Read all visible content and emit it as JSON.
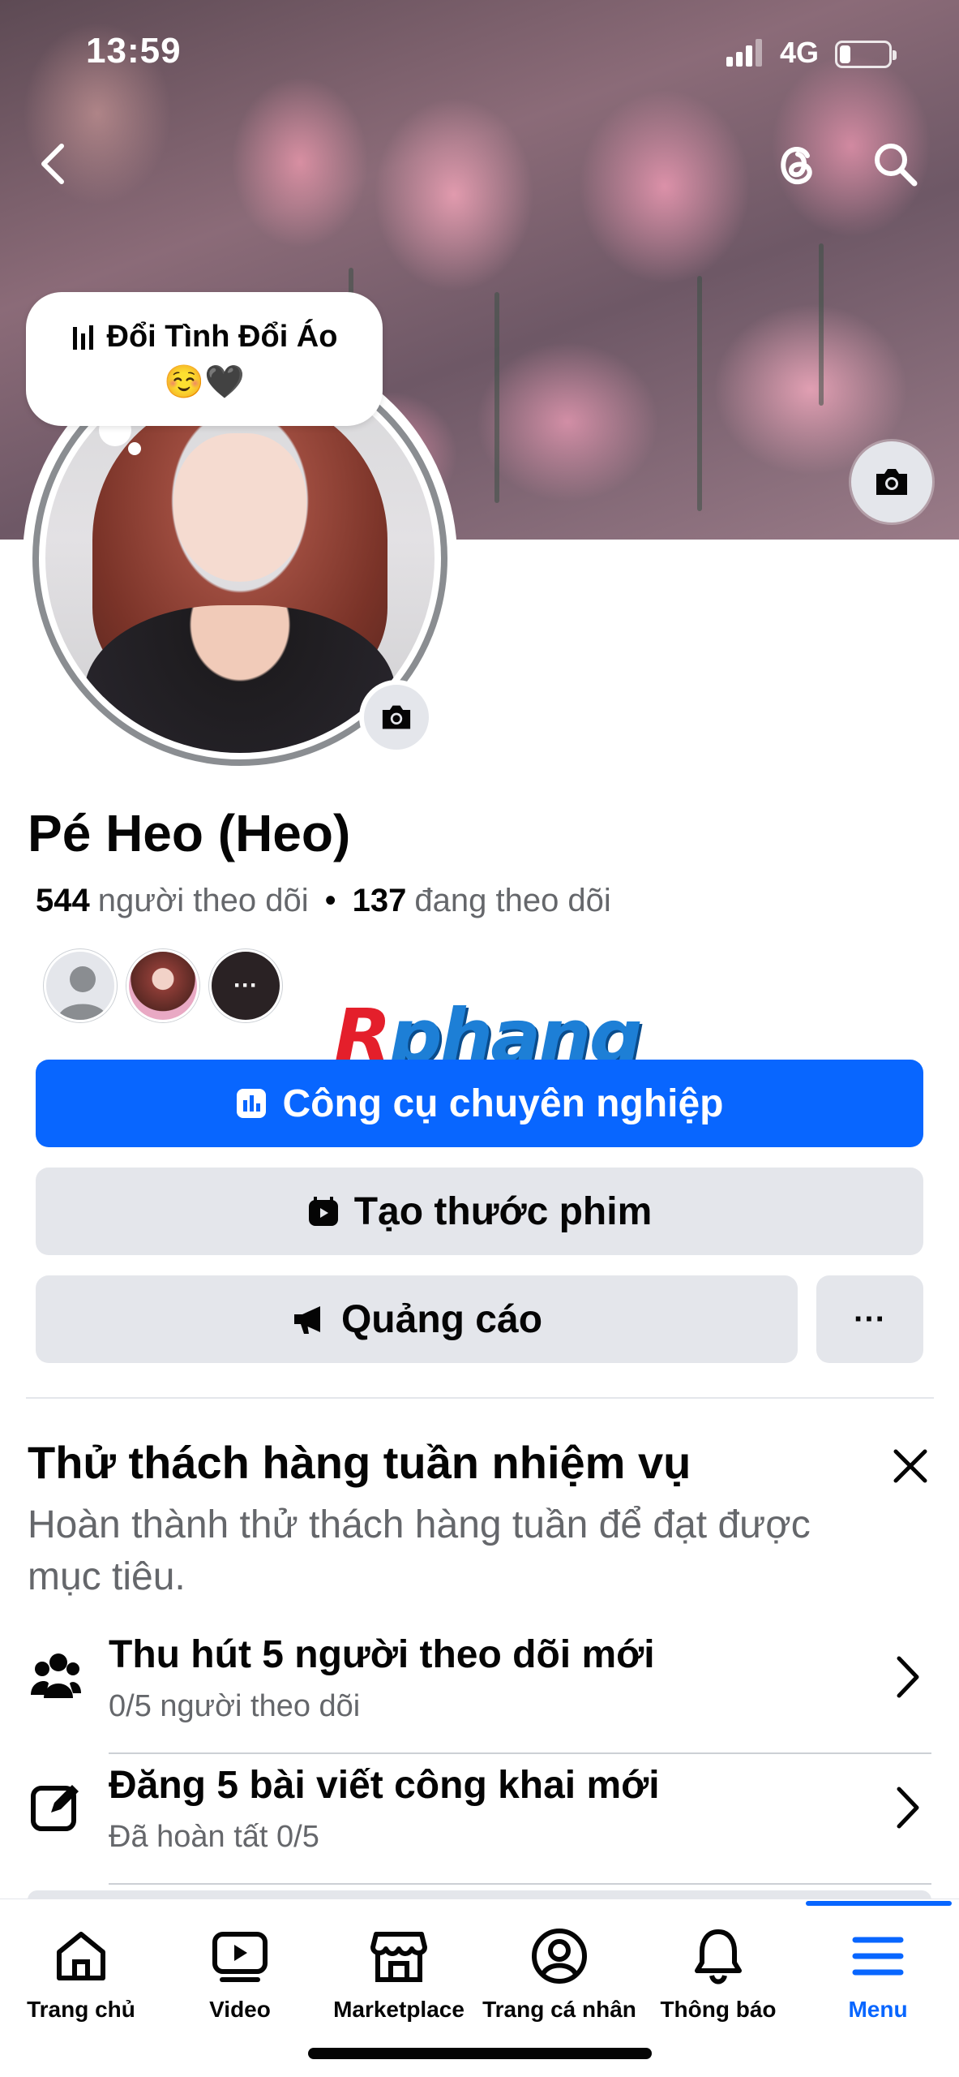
{
  "status_bar": {
    "time": "13:59",
    "network": "4G",
    "battery_level": 0.22
  },
  "profile": {
    "name": "Pé Heo (Heo)",
    "followers_count": "544",
    "followers_label": "người theo dõi",
    "separator": "•",
    "following_count": "137",
    "following_label": "đang theo dõi",
    "more_friends_label": "···"
  },
  "note": {
    "text": "Đổi Tình Đổi Áo",
    "emoji": "☺️🖤"
  },
  "watermark": {
    "first_letter": "R",
    "rest": "phang"
  },
  "actions": {
    "professional_tools": "Công cụ chuyên nghiệp",
    "create_reel": "Tạo thước phim",
    "ads": "Quảng cáo",
    "more": "···"
  },
  "weekly_challenge": {
    "title": "Thử thách hàng tuần nhiệm vụ",
    "description": "Hoàn thành thử thách hàng tuần để đạt được mục tiêu.",
    "tasks": [
      {
        "title": "Thu hút 5 người theo dõi mới",
        "subtitle": "0/5 người theo dõi",
        "icon": "people-icon"
      },
      {
        "title": "Đăng 5 bài viết công khai mới",
        "subtitle": "Đã hoàn tất 0/5",
        "icon": "edit-icon"
      }
    ]
  },
  "tabbar": {
    "items": [
      {
        "label": "Trang chủ",
        "icon": "home-icon"
      },
      {
        "label": "Video",
        "icon": "video-icon"
      },
      {
        "label": "Marketplace",
        "icon": "marketplace-icon"
      },
      {
        "label": "Trang cá nhân",
        "icon": "profile-icon"
      },
      {
        "label": "Thông báo",
        "icon": "bell-icon"
      },
      {
        "label": "Menu",
        "icon": "menu-icon"
      }
    ],
    "active_index": 5
  },
  "colors": {
    "primary": "#0866ff",
    "secondary_button": "#e4e6eb",
    "text_secondary": "#65676b"
  }
}
